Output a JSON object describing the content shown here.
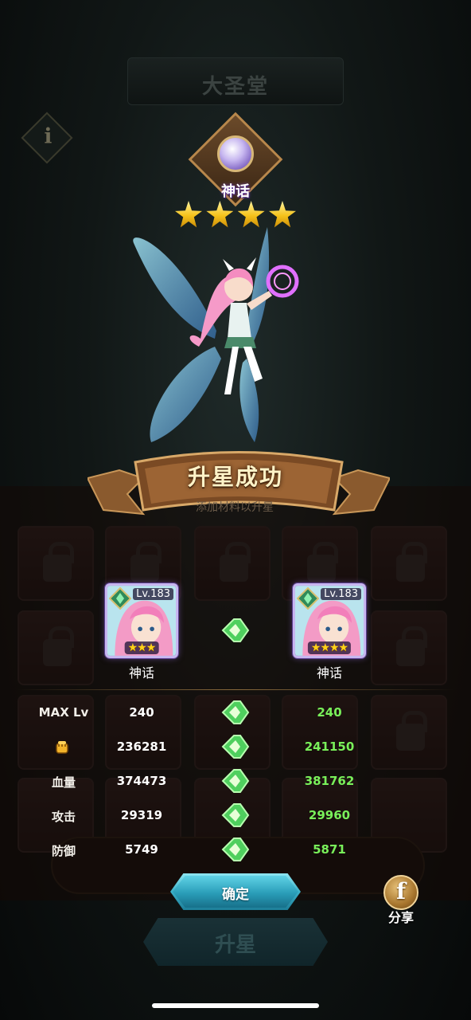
{
  "background": {
    "title": "大圣堂",
    "info_icon": "i",
    "hint_partial": "添加材料以升星",
    "upgrade_button_label": "升星"
  },
  "emblem": {
    "icon": "gem-rank-emblem-icon",
    "rank_label": "神话"
  },
  "star_count": 4,
  "banner": {
    "title": "升星成功"
  },
  "before": {
    "level": "Lv.183",
    "stars": "★★★",
    "rank": "神话"
  },
  "after": {
    "level": "Lv.183",
    "stars": "★★★★",
    "rank": "神话"
  },
  "stats": [
    {
      "label": "MAX Lv",
      "old": "240",
      "new": "240"
    },
    {
      "label": "",
      "icon": "power-fist-icon",
      "old": "236281",
      "new": "241150"
    },
    {
      "label": "血量",
      "old": "374473",
      "new": "381762"
    },
    {
      "label": "攻击",
      "old": "29319",
      "new": "29960"
    },
    {
      "label": "防御",
      "old": "5749",
      "new": "5871"
    }
  ],
  "confirm_label": "确定",
  "share": {
    "icon": "f",
    "label": "分享"
  },
  "colors": {
    "stat_new": "#79f05a",
    "card_border": "#c7b6f0",
    "confirm_button": "#2a9db8",
    "star_gold": "#f5c21a"
  }
}
